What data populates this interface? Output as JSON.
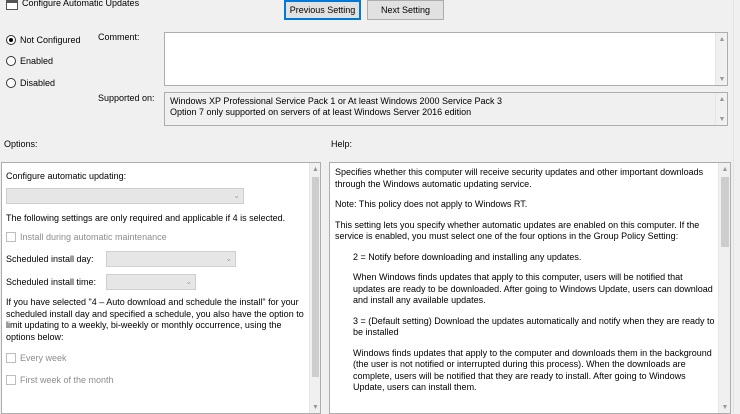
{
  "window": {
    "title": "Configure Automatic Updates"
  },
  "toolbar": {
    "previous_label": "Previous Setting",
    "next_label": "Next Setting"
  },
  "state": {
    "options": [
      {
        "label": "Not Configured",
        "selected": true
      },
      {
        "label": "Enabled",
        "selected": false
      },
      {
        "label": "Disabled",
        "selected": false
      }
    ]
  },
  "comment": {
    "label": "Comment:",
    "value": ""
  },
  "supported": {
    "label": "Supported on:",
    "line1": "Windows XP Professional Service Pack 1 or At least Windows 2000 Service Pack 3",
    "line2": "Option 7 only supported on servers of at least Windows Server 2016 edition"
  },
  "sections": {
    "options_label": "Options:",
    "help_label": "Help:"
  },
  "options_panel": {
    "configure_label": "Configure automatic updating:",
    "configure_value": "",
    "note": "The following settings are only required and applicable if 4 is selected.",
    "install_maintenance_label": "Install during automatic maintenance",
    "install_day_label": "Scheduled install day:",
    "install_day_value": "",
    "install_time_label": "Scheduled install time:",
    "install_time_value": "",
    "schedule_paragraph": "If you have selected \"4 – Auto download and schedule the install\" for your scheduled install day and specified a schedule, you also have the option to limit updating to a weekly, bi-weekly or monthly occurrence, using the options below:",
    "every_week_label": "Every week",
    "first_week_label": "First week of the month"
  },
  "help_panel": {
    "p1": "Specifies whether this computer will receive security updates and other important downloads through the Windows automatic updating service.",
    "p2": "Note: This policy does not apply to Windows RT.",
    "p3": "This setting lets you specify whether automatic updates are enabled on this computer. If the service is enabled, you must select one of the four options in the Group Policy Setting:",
    "p4": "2 = Notify before downloading and installing any updates.",
    "p5": "When Windows finds updates that apply to this computer, users will be notified that updates are ready to be downloaded. After going to Windows Update, users can download and install any available updates.",
    "p6": "3 = (Default setting) Download the updates automatically and notify when they are ready to be installed",
    "p7": "Windows finds updates that apply to the computer and downloads them in the background (the user is not notified or interrupted during this process). When the downloads are complete, users will be notified that they are ready to install. After going to Windows Update, users can install them."
  }
}
